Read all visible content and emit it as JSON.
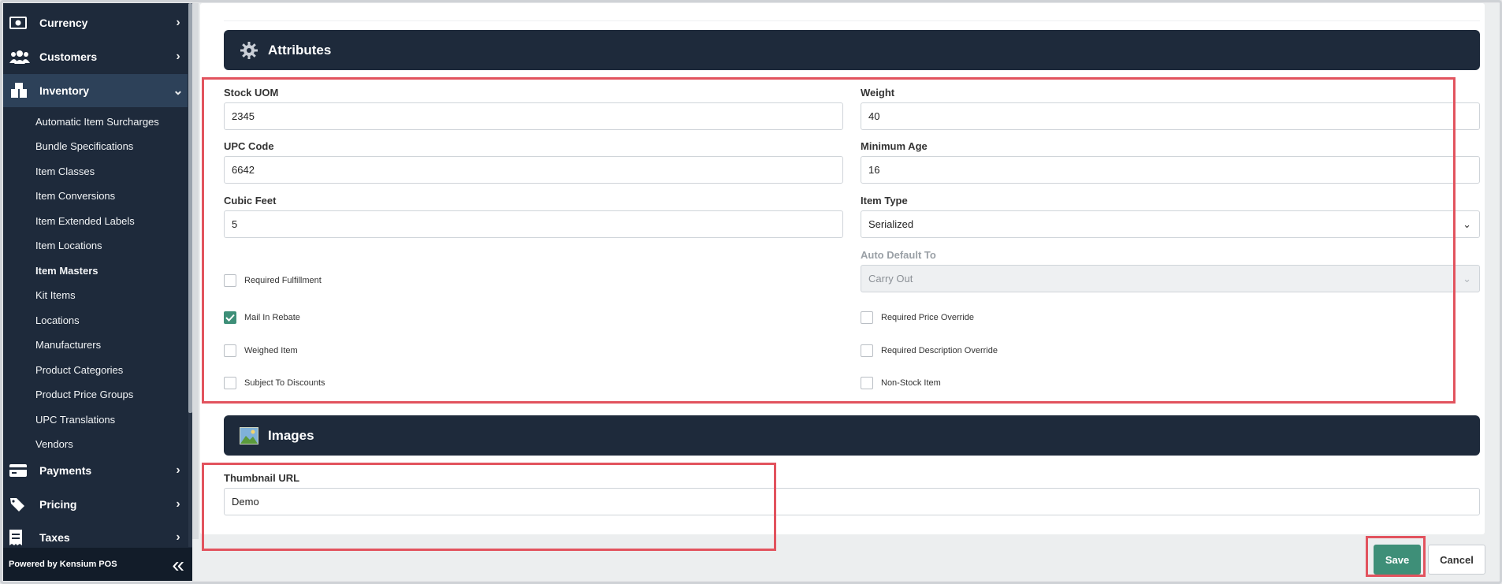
{
  "sidebar": {
    "top_items": [
      {
        "label": "Currency",
        "icon": "currency-icon"
      },
      {
        "label": "Customers",
        "icon": "customers-icon"
      },
      {
        "label": "Inventory",
        "icon": "inventory-icon"
      },
      {
        "label": "Payments",
        "icon": "payments-icon"
      },
      {
        "label": "Pricing",
        "icon": "pricing-icon"
      },
      {
        "label": "Taxes",
        "icon": "taxes-icon"
      }
    ],
    "inventory_subitems": [
      "Automatic Item Surcharges",
      "Bundle Specifications",
      "Item Classes",
      "Item Conversions",
      "Item Extended Labels",
      "Item Locations",
      "Item Masters",
      "Kit Items",
      "Locations",
      "Manufacturers",
      "Product Categories",
      "Product Price Groups",
      "UPC Translations",
      "Vendors"
    ],
    "active_subitem": "Item Masters",
    "footer": "Powered by Kensium POS",
    "collapse_glyph": "«"
  },
  "attributes": {
    "title": "Attributes",
    "stock_uom": {
      "label": "Stock UOM",
      "value": "2345"
    },
    "weight": {
      "label": "Weight",
      "value": "40"
    },
    "upc_code": {
      "label": "UPC Code",
      "value": "6642"
    },
    "minimum_age": {
      "label": "Minimum Age",
      "value": "16"
    },
    "cubic_feet": {
      "label": "Cubic Feet",
      "value": "5"
    },
    "item_type": {
      "label": "Item Type",
      "value": "Serialized"
    },
    "auto_default_to": {
      "label": "Auto Default To",
      "value": "Carry Out"
    },
    "checkboxes": {
      "required_fulfillment": {
        "label": "Required Fulfillment",
        "checked": false
      },
      "mail_in_rebate": {
        "label": "Mail In Rebate",
        "checked": true
      },
      "weighed_item": {
        "label": "Weighed Item",
        "checked": false
      },
      "subject_to_discounts": {
        "label": "Subject To Discounts",
        "checked": false
      },
      "required_price_override": {
        "label": "Required Price Override",
        "checked": false
      },
      "required_description_override": {
        "label": "Required Description Override",
        "checked": false
      },
      "non_stock_item": {
        "label": "Non-Stock Item",
        "checked": false
      }
    }
  },
  "images": {
    "title": "Images",
    "thumbnail_url": {
      "label": "Thumbnail URL",
      "value": "Demo"
    }
  },
  "actions": {
    "save_label": "Save",
    "cancel_label": "Cancel"
  },
  "colors": {
    "sidebar_bg": "#1e2a3b",
    "accent_green": "#3e8f78",
    "highlight_red": "#e2535e"
  }
}
